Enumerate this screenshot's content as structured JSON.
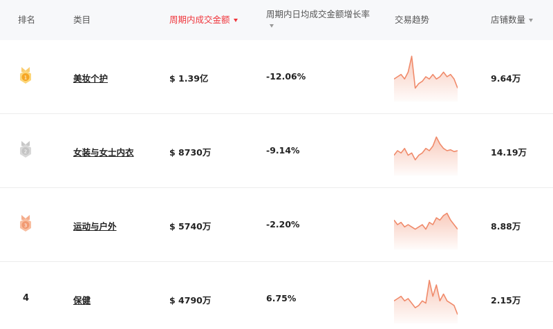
{
  "header": {
    "rank": "排名",
    "category": "类目",
    "amount": "周期内成交金额",
    "growth": "周期内日均成交金额增长率",
    "trend": "交易趋势",
    "shops": "店铺数量"
  },
  "colors": {
    "accent": "#f0353b",
    "trend_line": "#f08a6a",
    "gold": "#f5a623",
    "silver": "#b8b8b8",
    "bronze": "#f19a72"
  },
  "rows": [
    {
      "rank": "1",
      "medal": "gold-medal-icon",
      "category": "美妆个护",
      "amount": "$ 1.39亿",
      "growth": "-12.06%",
      "shops": "9.64万",
      "trend": [
        0.55,
        0.5,
        0.45,
        0.55,
        0.4,
        0.05,
        0.75,
        0.65,
        0.6,
        0.5,
        0.55,
        0.45,
        0.55,
        0.5,
        0.4,
        0.5,
        0.45,
        0.55,
        0.75
      ]
    },
    {
      "rank": "2",
      "medal": "silver-medal-icon",
      "category": "女装与女士内衣",
      "amount": "$ 8730万",
      "growth": "-9.14%",
      "shops": "14.19万",
      "trend": [
        0.6,
        0.5,
        0.55,
        0.45,
        0.6,
        0.55,
        0.7,
        0.6,
        0.55,
        0.45,
        0.5,
        0.4,
        0.2,
        0.35,
        0.45,
        0.5,
        0.48,
        0.52,
        0.5
      ]
    },
    {
      "rank": "3",
      "medal": "bronze-medal-icon",
      "category": "运动与户外",
      "amount": "$ 5740万",
      "growth": "-2.20%",
      "shops": "8.88万",
      "trend": [
        0.4,
        0.5,
        0.45,
        0.55,
        0.5,
        0.55,
        0.6,
        0.55,
        0.5,
        0.6,
        0.45,
        0.5,
        0.35,
        0.4,
        0.3,
        0.25,
        0.4,
        0.5,
        0.6
      ]
    },
    {
      "rank": "4",
      "medal": "",
      "category": "保健",
      "amount": "$ 4790万",
      "growth": "6.75%",
      "shops": "2.15万",
      "trend": [
        0.55,
        0.5,
        0.45,
        0.55,
        0.5,
        0.6,
        0.7,
        0.65,
        0.55,
        0.6,
        0.1,
        0.45,
        0.2,
        0.55,
        0.4,
        0.55,
        0.6,
        0.65,
        0.85
      ]
    }
  ]
}
